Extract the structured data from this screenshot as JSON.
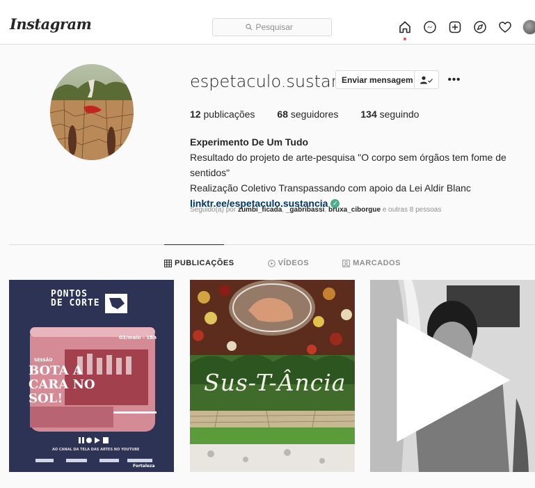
{
  "app": {
    "logo": "Instagram"
  },
  "search": {
    "placeholder": "Pesquisar"
  },
  "nav": {
    "icons": [
      "home-icon",
      "messenger-icon",
      "new-post-icon",
      "explore-icon",
      "activity-heart-icon",
      "profile-avatar"
    ]
  },
  "profile": {
    "username": "espetaculo.sustancia",
    "message_button": "Enviar mensagem",
    "following_button_icon": "person-check-icon",
    "more_button": "•••",
    "stats": {
      "posts_count": "12",
      "posts_label": "publicações",
      "followers_count": "68",
      "followers_label": "seguidores",
      "following_count": "134",
      "following_label": "seguindo"
    },
    "bio": {
      "full_name": "Experimento De Um Tudo",
      "line1": "Resultado do projeto de arte-pesquisa \"O corpo sem órgãos tem fome de sentidos\"",
      "line2": "Realização Coletivo Transpassando com apoio da Lei Aldir Blanc",
      "link": "linktr.ee/espetaculo.sustancia"
    },
    "followed_by": {
      "prefix": "Seguido(a) por",
      "user1": "zumbi_ficada",
      "user2": "_gabribassi",
      "user3": "bruxa_ciborgue",
      "suffix": "e outras 8 pessoas"
    }
  },
  "tabs": [
    {
      "label": "PUBLICAÇÕES",
      "icon": "grid-icon",
      "active": true
    },
    {
      "label": "VÍDEOS",
      "icon": "play-circle-icon",
      "active": false
    },
    {
      "label": "MARCADOS",
      "icon": "tag-person-icon",
      "active": false
    }
  ],
  "posts": {
    "post1": {
      "title_line1": "PONTOS",
      "title_line2": "DE CORTE",
      "date": "03/maio - 18h",
      "session": "SESSÃO",
      "headline_line1": "BOTA A",
      "headline_line2": "CARA NO",
      "headline_line3": "SOL!",
      "footer": "AO CANAL DA TELA DAS ARTES NO YOUTUBE",
      "sponsor": "Fortaleza"
    },
    "post2": {
      "title": "Sus-T-Ância"
    },
    "post3": {
      "badge": "video"
    }
  },
  "colors": {
    "link": "#00376b",
    "verified": "#4caf89",
    "notification_dot": "#ed4956",
    "post1_bg": "#2c3354",
    "post1_pink": "#d58b95"
  }
}
